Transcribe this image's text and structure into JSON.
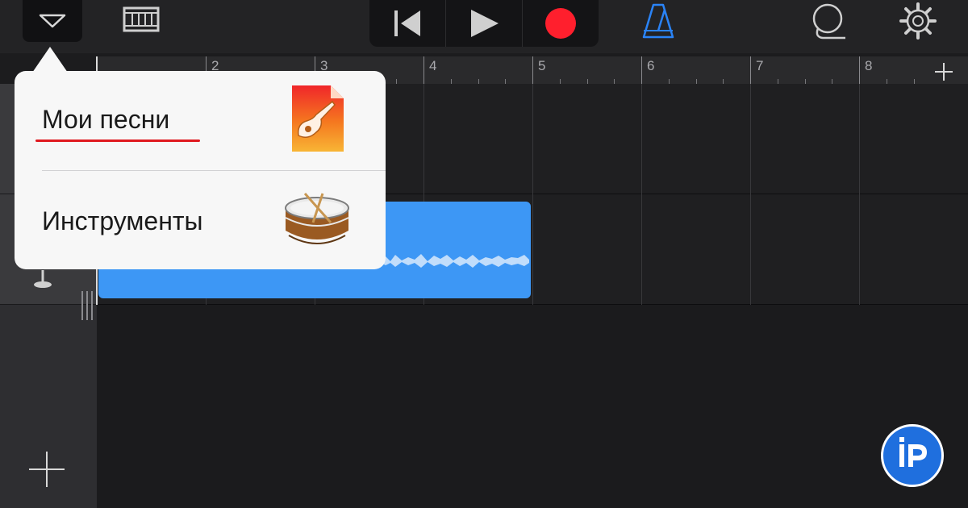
{
  "toolbar": {
    "icons": {
      "browser": "triangle-down-icon",
      "tracks_view": "tracks-view-icon",
      "rewind": "go-to-start-icon",
      "play": "play-icon",
      "record": "record-icon",
      "metronome": "metronome-icon",
      "loop": "loop-browser-icon",
      "settings": "gear-icon"
    },
    "colors": {
      "record": "#ff1f2d",
      "metronome": "#2a83f6"
    }
  },
  "ruler": {
    "bars": [
      "2",
      "3",
      "4",
      "5",
      "6",
      "7",
      "8"
    ]
  },
  "popover": {
    "items": [
      {
        "label": "Мои песни",
        "icon": "garageband-document-icon"
      },
      {
        "label": "Инструменты",
        "icon": "snare-drum-icon"
      }
    ],
    "underline_color": "#e0191f"
  },
  "region": {
    "color": "#3d97f5"
  },
  "watermark": {
    "text": "iP",
    "color": "#1f6fde"
  }
}
